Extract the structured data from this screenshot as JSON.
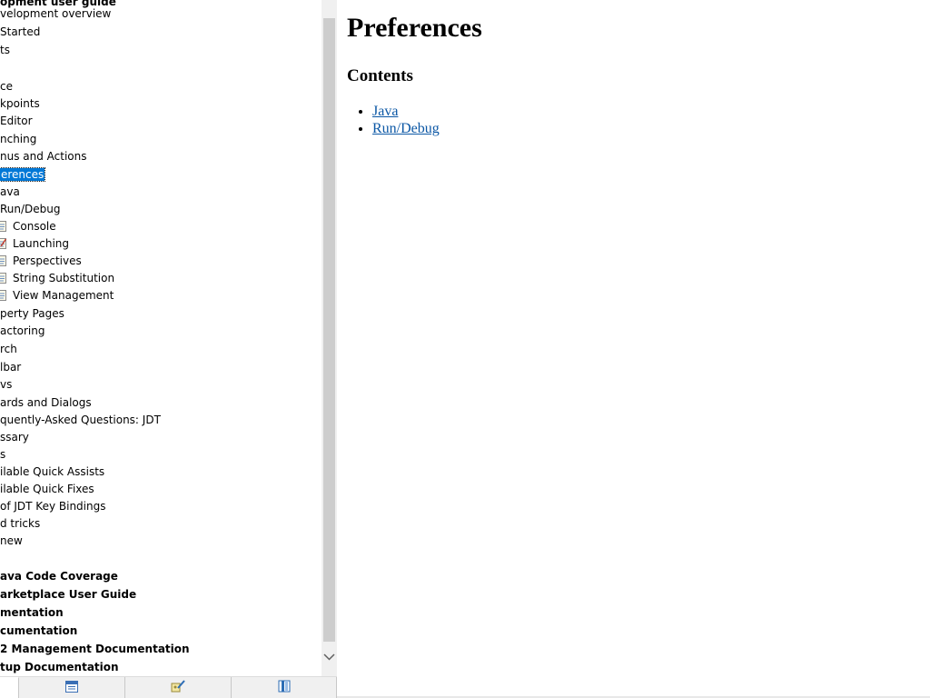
{
  "toc": {
    "rows": [
      {
        "label": "opment user guide",
        "bold": true
      },
      {
        "label": "velopment overview"
      },
      {
        "label": " Started"
      },
      {
        "label": "ts"
      },
      {
        "label": ""
      },
      {
        "label": "ce"
      },
      {
        "label": "kpoints"
      },
      {
        "label": " Editor"
      },
      {
        "label": "nching"
      },
      {
        "label": "nus and Actions"
      },
      {
        "label": "erences",
        "selected": true
      },
      {
        "label": "ava"
      },
      {
        "label": "Run/Debug"
      },
      {
        "label": "Console",
        "icon": "doc"
      },
      {
        "label": "Launching",
        "icon": "doc-edit"
      },
      {
        "label": "Perspectives",
        "icon": "doc"
      },
      {
        "label": "String Substitution",
        "icon": "doc"
      },
      {
        "label": "View Management",
        "icon": "doc"
      },
      {
        "label": "perty Pages"
      },
      {
        "label": "actoring"
      },
      {
        "label": "rch"
      },
      {
        "label": "lbar"
      },
      {
        "label": "vs"
      },
      {
        "label": "ards and Dialogs"
      },
      {
        "label": "quently-Asked Questions: JDT"
      },
      {
        "label": "ssary"
      },
      {
        "label": "s"
      },
      {
        "label": "ilable Quick Assists"
      },
      {
        "label": "ilable Quick Fixes"
      },
      {
        "label": "of JDT Key Bindings"
      },
      {
        "label": "d tricks"
      },
      {
        "label": "new"
      },
      {
        "label": ""
      },
      {
        "label": "ava Code Coverage",
        "bold": true
      },
      {
        "label": "arketplace User Guide",
        "bold": true
      },
      {
        "label": "mentation",
        "bold": true
      },
      {
        "label": "cumentation",
        "bold": true
      },
      {
        "label": "2 Management Documentation",
        "bold": true
      },
      {
        "label": "tup Documentation",
        "bold": true
      }
    ]
  },
  "bottom_tabs": [
    {
      "icon": "contents-icon",
      "active": false
    },
    {
      "icon": "index-icon",
      "active": false
    },
    {
      "icon": "bookmarks-icon",
      "active": false
    }
  ],
  "content": {
    "title": "Preferences",
    "contents_heading": "Contents",
    "links": [
      "Java",
      "Run/Debug"
    ]
  },
  "colors": {
    "selection": "#0078d7",
    "link": "#0b57a5"
  }
}
